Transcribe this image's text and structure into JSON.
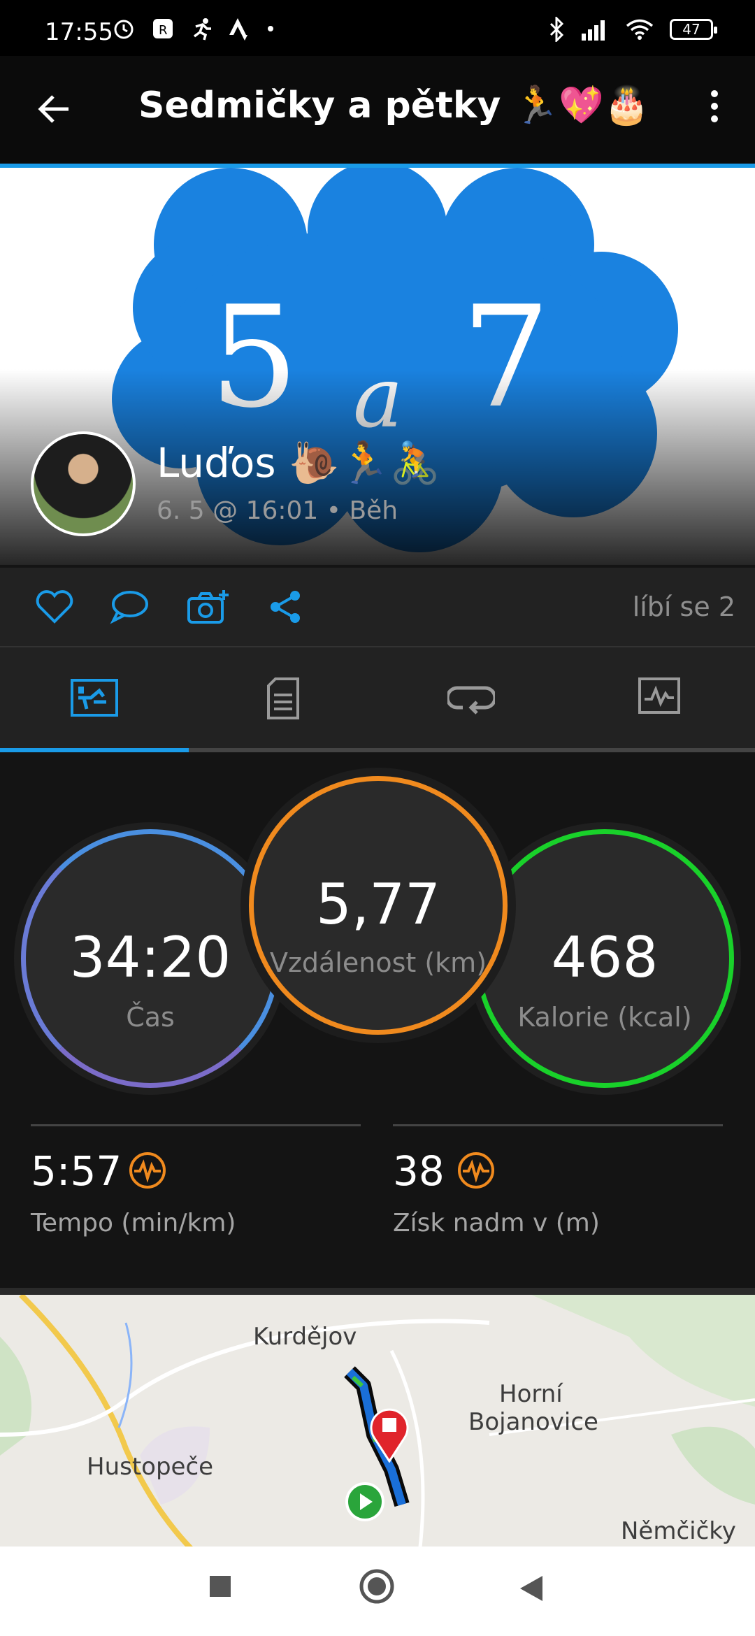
{
  "status_bar": {
    "time": "17:55",
    "battery": "47",
    "left_icons": [
      "alarm-icon",
      "r-app-icon",
      "runner-icon",
      "strava-icon",
      "dot-icon"
    ],
    "right_icons": [
      "bluetooth-icon",
      "signal-icon",
      "wifi-icon",
      "battery-icon"
    ]
  },
  "app_bar": {
    "title": "Sedmičky a pětky 🏃💖🎂",
    "back_icon": "back-arrow-icon",
    "menu_icon": "more-vert-icon"
  },
  "hero": {
    "banner_text": [
      "5",
      "a",
      "7"
    ],
    "banner_color": "#1a82e0",
    "user_name": "Luďos 🐌🏃🚴",
    "meta": "6. 5 @ 16:01 • Běh"
  },
  "actions": {
    "icons": [
      "heart-icon",
      "comment-icon",
      "add-photo-icon",
      "share-icon"
    ],
    "likes": "líbí se 2",
    "accent": "#1a9be8"
  },
  "tabs": {
    "items": [
      "stats-tab-icon",
      "details-tab-icon",
      "laps-tab-icon",
      "charts-tab-icon"
    ],
    "active_index": 0
  },
  "stats": {
    "time": {
      "value": "34:20",
      "label": "Čas"
    },
    "distance": {
      "value": "5,77",
      "label": "Vzdálenost (km)"
    },
    "calories": {
      "value": "468",
      "label": "Kalorie (kcal)"
    },
    "pace": {
      "value": "5:57",
      "label": "Tempo (min/km)"
    },
    "elevation": {
      "value": "38",
      "label": "Získ nadm v (m)"
    }
  },
  "map": {
    "places": [
      "Kurdějov",
      "Horní",
      "Bojanovice",
      "Hustopeče",
      "Němčičky"
    ]
  },
  "nav": {
    "icons": [
      "recents-icon",
      "home-icon",
      "back-icon"
    ]
  }
}
